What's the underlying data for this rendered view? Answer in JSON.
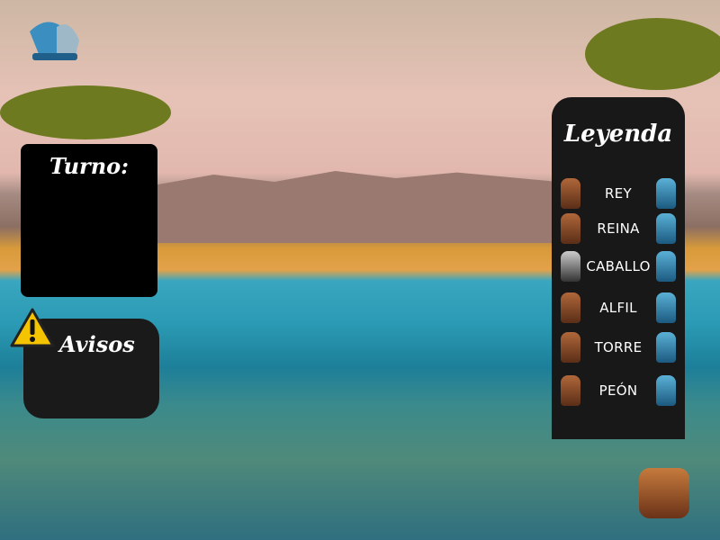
{
  "turn_panel": {
    "title": "Turno:"
  },
  "warnings_panel": {
    "title": "Avisos",
    "icon": "warning-icon"
  },
  "legend": {
    "title": "Leyenda",
    "items": [
      {
        "label": "REY",
        "white": "lion-king-piece",
        "black": "shark-king-piece"
      },
      {
        "label": "REINA",
        "white": "lioness-queen-piece",
        "black": "orca-queen-piece"
      },
      {
        "label": "CABALLO",
        "white": "zebra-knight-piece",
        "black": "seahorse-knight-piece"
      },
      {
        "label": "ALFIL",
        "white": "duck-bishop-piece",
        "black": "octopus-bishop-piece"
      },
      {
        "label": "TORRE",
        "white": "giraffe-rook-piece",
        "black": "crab-rook-piece"
      },
      {
        "label": "PEÓN",
        "white": "rabbit-pawn-piece",
        "black": "shrimp-pawn-piece"
      }
    ]
  },
  "colors": {
    "panel": "#000000",
    "legend_bg": "#181818",
    "warning": "#f5c400"
  }
}
